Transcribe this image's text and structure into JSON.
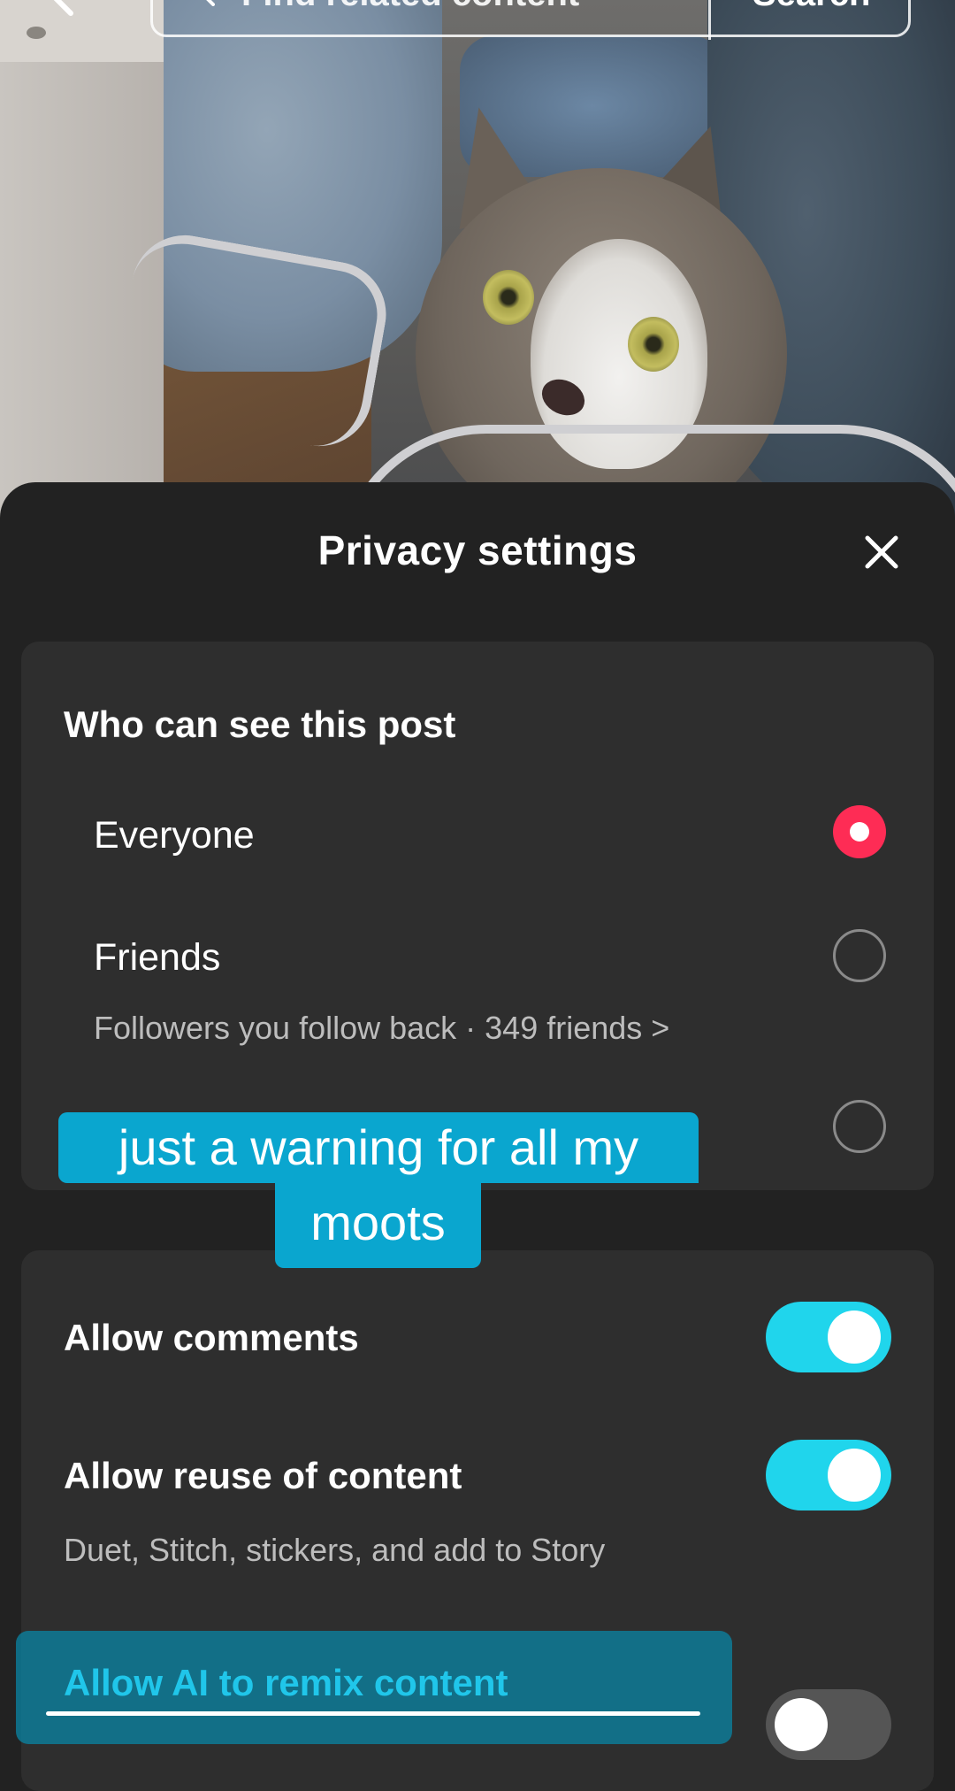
{
  "search": {
    "placeholder": "Find related content",
    "button_label": "Search"
  },
  "sheet": {
    "title": "Privacy settings"
  },
  "visibility": {
    "title": "Who can see this post",
    "options": [
      {
        "label": "Everyone",
        "selected": true
      },
      {
        "label": "Friends",
        "subtitle": "Followers you follow back · 349 friends >",
        "selected": false
      },
      {
        "label": "",
        "selected": false
      }
    ]
  },
  "settings": {
    "allow_comments": {
      "label": "Allow comments",
      "enabled": true
    },
    "allow_reuse": {
      "label": "Allow reuse of content",
      "subtitle": "Duet, Stitch, stickers, and add to Story",
      "enabled": true
    },
    "allow_ai_remix": {
      "label": "Allow AI to remix content",
      "enabled": false
    }
  },
  "caption": {
    "line1": "just a warning for all my",
    "line2": "moots"
  },
  "colors": {
    "accent_red": "#fe2c55",
    "toggle_on": "#20d5ec",
    "caption_bg": "#0aa6cf"
  }
}
